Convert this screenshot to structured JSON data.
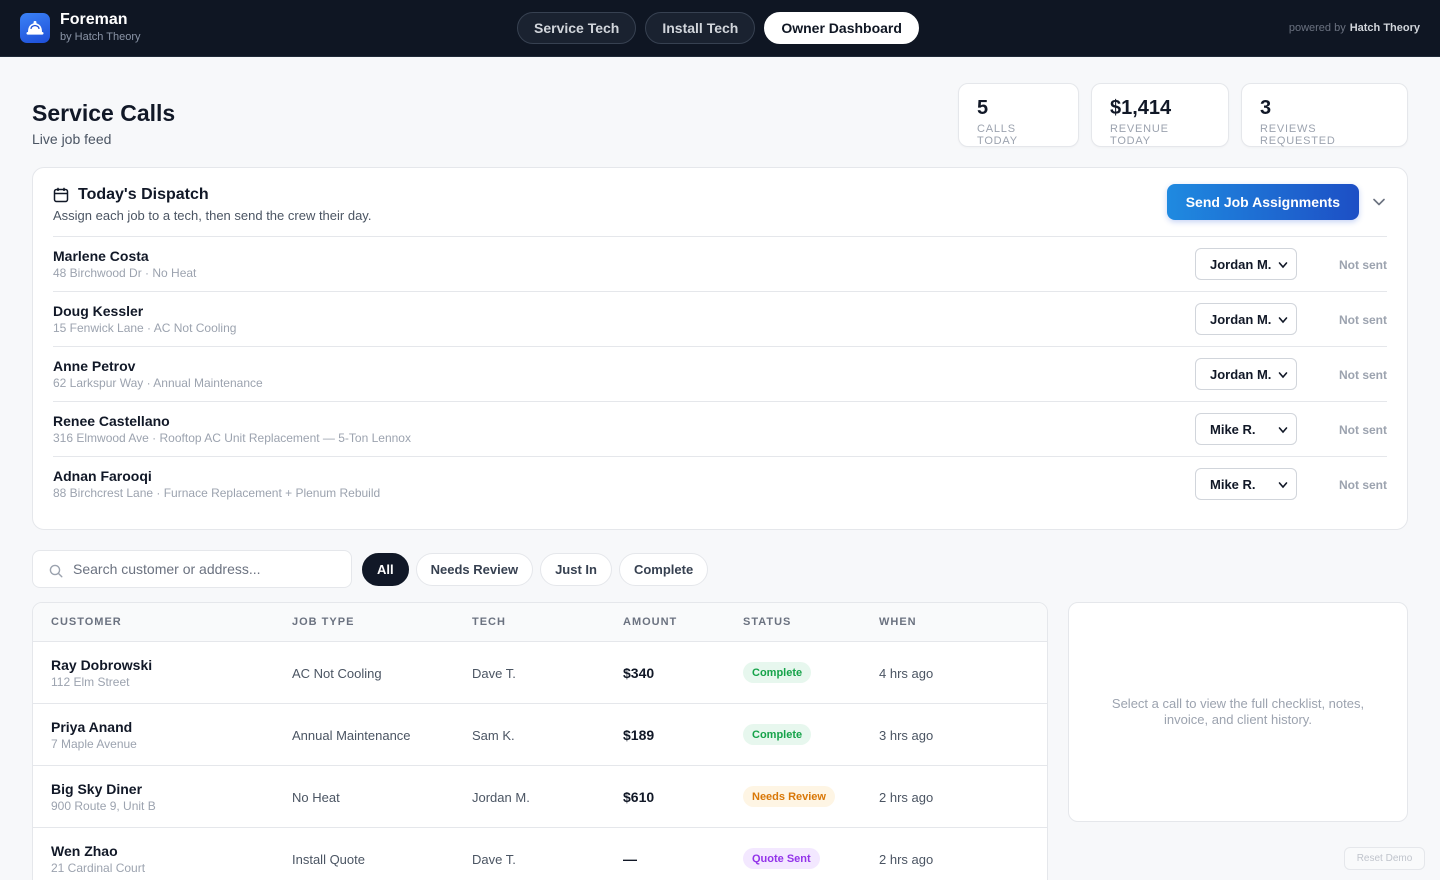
{
  "app": {
    "name": "Foreman",
    "byline": "by Hatch Theory",
    "powered_by_prefix": "powered by",
    "powered_by_brand": "Hatch Theory"
  },
  "mode_tabs": [
    {
      "label": "Service Tech",
      "active": false
    },
    {
      "label": "Install Tech",
      "active": false
    },
    {
      "label": "Owner Dashboard",
      "active": true
    }
  ],
  "page": {
    "title": "Service Calls",
    "subtitle": "Live job feed"
  },
  "stats": [
    {
      "value": "5",
      "label": "CALLS TODAY"
    },
    {
      "value": "$1,414",
      "label": "REVENUE TODAY"
    },
    {
      "value": "3",
      "label": "REVIEWS REQUESTED"
    }
  ],
  "dispatch": {
    "title": "Today's Dispatch",
    "description": "Assign each job to a tech, then send the crew their day.",
    "send_button": "Send Job Assignments",
    "rows": [
      {
        "name": "Marlene Costa",
        "meta": "48 Birchwood Dr · No Heat",
        "tech": "Jordan M.",
        "status": "Not sent"
      },
      {
        "name": "Doug Kessler",
        "meta": "15 Fenwick Lane · AC Not Cooling",
        "tech": "Jordan M.",
        "status": "Not sent"
      },
      {
        "name": "Anne Petrov",
        "meta": "62 Larkspur Way · Annual Maintenance",
        "tech": "Jordan M.",
        "status": "Not sent"
      },
      {
        "name": "Renee Castellano",
        "meta": "316 Elmwood Ave · Rooftop AC Unit Replacement — 5-Ton Lennox",
        "tech": "Mike R.",
        "status": "Not sent"
      },
      {
        "name": "Adnan Farooqi",
        "meta": "88 Birchcrest Lane · Furnace Replacement + Plenum Rebuild",
        "tech": "Mike R.",
        "status": "Not sent"
      }
    ]
  },
  "search": {
    "placeholder": "Search customer or address...",
    "value": ""
  },
  "filters": [
    {
      "label": "All",
      "active": true
    },
    {
      "label": "Needs Review",
      "active": false
    },
    {
      "label": "Just In",
      "active": false
    },
    {
      "label": "Complete",
      "active": false
    }
  ],
  "table": {
    "columns": [
      "CUSTOMER",
      "JOB TYPE",
      "TECH",
      "AMOUNT",
      "STATUS",
      "WHEN"
    ],
    "rows": [
      {
        "customer": "Ray Dobrowski",
        "address": "112 Elm Street",
        "job_type": "AC Not Cooling",
        "tech": "Dave T.",
        "amount": "$340",
        "status": "Complete",
        "when": "4 hrs ago"
      },
      {
        "customer": "Priya Anand",
        "address": "7 Maple Avenue",
        "job_type": "Annual Maintenance",
        "tech": "Sam K.",
        "amount": "$189",
        "status": "Complete",
        "when": "3 hrs ago"
      },
      {
        "customer": "Big Sky Diner",
        "address": "900 Route 9, Unit B",
        "job_type": "No Heat",
        "tech": "Jordan M.",
        "amount": "$610",
        "status": "Needs Review",
        "when": "2 hrs ago"
      },
      {
        "customer": "Wen Zhao",
        "address": "21 Cardinal Court",
        "job_type": "Install Quote",
        "tech": "Dave T.",
        "amount": "—",
        "status": "Quote Sent",
        "when": "2 hrs ago"
      }
    ]
  },
  "status_colors": {
    "Complete": {
      "bg": "#e7f7ee",
      "fg": "#16a34a"
    },
    "Needs Review": {
      "bg": "#fef5e4",
      "fg": "#d97706"
    },
    "Quote Sent": {
      "bg": "#f3e8ff",
      "fg": "#9333ea"
    }
  },
  "detail": {
    "empty_text": "Select a call to view the full checklist, notes, invoice, and client history."
  },
  "reset_button": "Reset Demo"
}
